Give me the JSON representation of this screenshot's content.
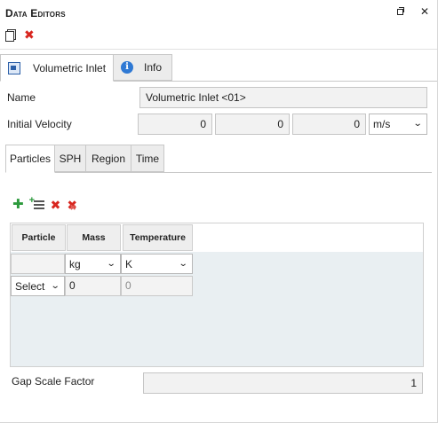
{
  "window": {
    "title": "Data Editors",
    "restore_icon": "restore-window-icon",
    "close_icon": "close-icon"
  },
  "toolbar": {
    "new_icon": "copy-document-icon",
    "delete_icon": "delete-red-x-icon"
  },
  "tabs": [
    {
      "label": "Volumetric Inlet",
      "icon": "volumetric-inlet-icon",
      "active": true
    },
    {
      "label": "Info",
      "icon": "info-icon",
      "active": false
    }
  ],
  "form": {
    "name_label": "Name",
    "name_value": "Volumetric Inlet <01>",
    "velocity_label": "Initial Velocity",
    "velocity_values": [
      "0",
      "0",
      "0"
    ],
    "velocity_unit": "m/s"
  },
  "inner_tabs": [
    "Particles",
    "SPH",
    "Region",
    "Time"
  ],
  "particles": {
    "tools": [
      "add-icon",
      "add-list-icon",
      "delete-icon",
      "delete-multiple-icon"
    ],
    "columns": [
      "Particle",
      "Mass",
      "Temperature"
    ],
    "units": [
      "",
      "kg",
      "K"
    ],
    "rows": [
      {
        "particle": "Select",
        "mass": "0",
        "temperature": "0"
      }
    ]
  },
  "gap": {
    "label": "Gap Scale Factor",
    "value": "1"
  },
  "colors": {
    "accent": "#2f79d4",
    "delete": "#d8261f",
    "add": "#2c9a3c",
    "grid_bg": "#e9eff2"
  }
}
